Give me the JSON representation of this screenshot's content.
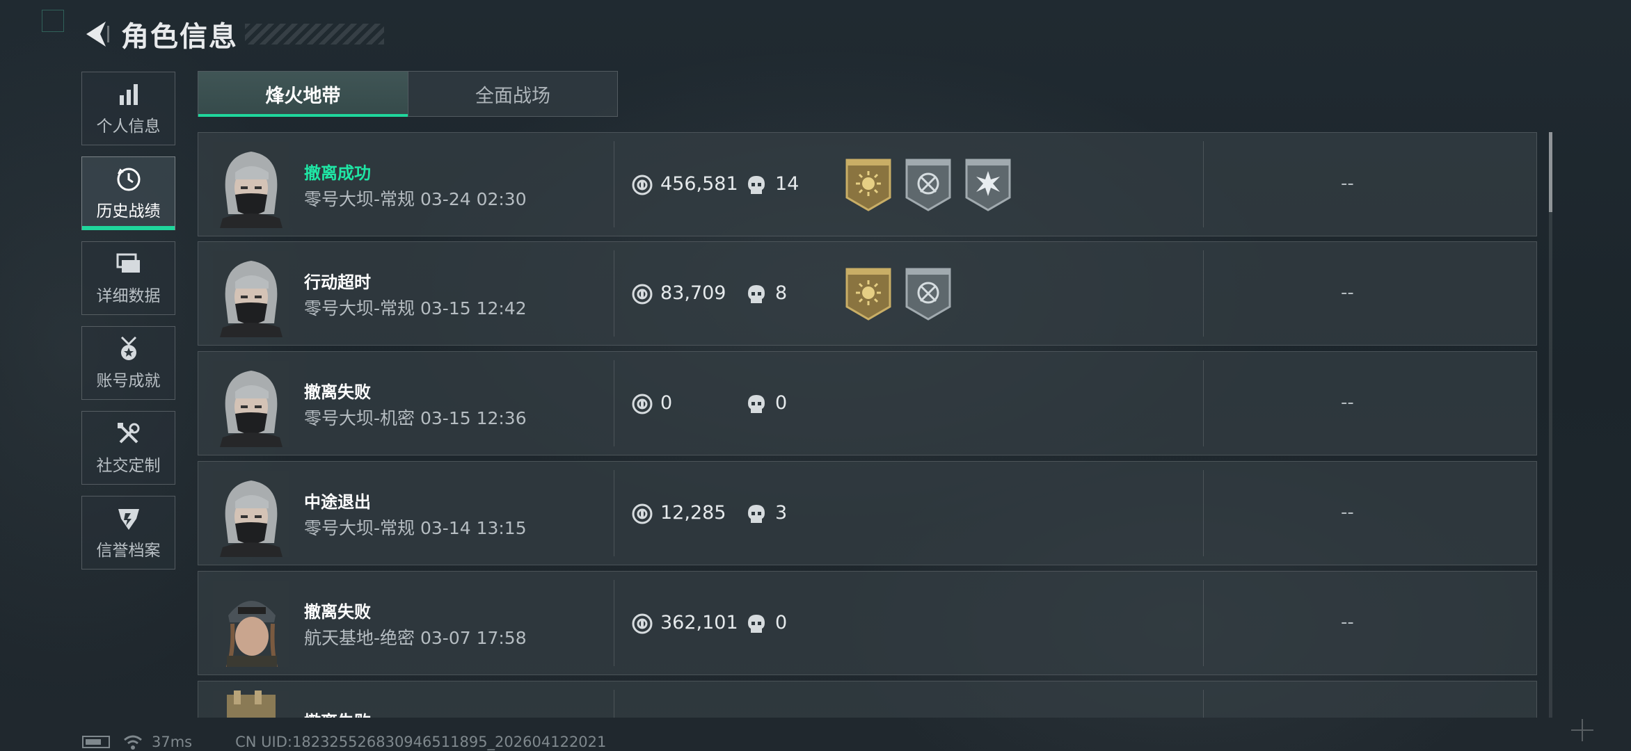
{
  "header": {
    "title": "角色信息",
    "back_icon": "back-arrow-icon"
  },
  "sidebar": {
    "items": [
      {
        "label": "个人信息",
        "icon": "bar-chart-icon",
        "active": false
      },
      {
        "label": "历史战绩",
        "icon": "clock-icon",
        "active": true
      },
      {
        "label": "详细数据",
        "icon": "stack-icon",
        "active": false
      },
      {
        "label": "账号成就",
        "icon": "medal-icon",
        "active": false
      },
      {
        "label": "社交定制",
        "icon": "tools-icon",
        "active": false
      },
      {
        "label": "信誉档案",
        "icon": "shield-icon",
        "active": false
      }
    ]
  },
  "tabs": [
    {
      "label": "烽火地带",
      "active": true
    },
    {
      "label": "全面战场",
      "active": false
    }
  ],
  "records": [
    {
      "status": "撤离成功",
      "status_type": "success",
      "map": "零号大坝-常规",
      "time": "03-24 02:30",
      "coins": "456,581",
      "kills": "14",
      "badges": [
        "sun-badge-gold",
        "target-badge-silver",
        "burst-badge-silver"
      ],
      "extra": "--"
    },
    {
      "status": "行动超时",
      "status_type": "normal",
      "map": "零号大坝-常规",
      "time": "03-15 12:42",
      "coins": "83,709",
      "kills": "8",
      "badges": [
        "sun-badge-gold",
        "target-badge-silver"
      ],
      "extra": "--"
    },
    {
      "status": "撤离失败",
      "status_type": "normal",
      "map": "零号大坝-机密",
      "time": "03-15 12:36",
      "coins": "0",
      "kills": "0",
      "badges": [],
      "extra": "--"
    },
    {
      "status": "中途退出",
      "status_type": "normal",
      "map": "零号大坝-常规",
      "time": "03-14 13:15",
      "coins": "12,285",
      "kills": "3",
      "badges": [],
      "extra": "--"
    },
    {
      "status": "撤离失败",
      "status_type": "normal",
      "map": "航天基地-绝密",
      "time": "03-07 17:58",
      "coins": "362,101",
      "kills": "0",
      "badges": [],
      "extra": "--"
    },
    {
      "status": "撤离失败",
      "status_type": "normal",
      "map": "",
      "time": "",
      "coins": "",
      "kills": "",
      "badges": [],
      "extra": ""
    }
  ],
  "footer": {
    "ping": "37ms",
    "uid": "CN UID:18232552683094651189​5_202604122021"
  },
  "colors": {
    "accent": "#1fd69c",
    "success_text": "#1fe6a5",
    "badge_gold": "#b89a4e",
    "badge_silver": "#8e979c"
  }
}
